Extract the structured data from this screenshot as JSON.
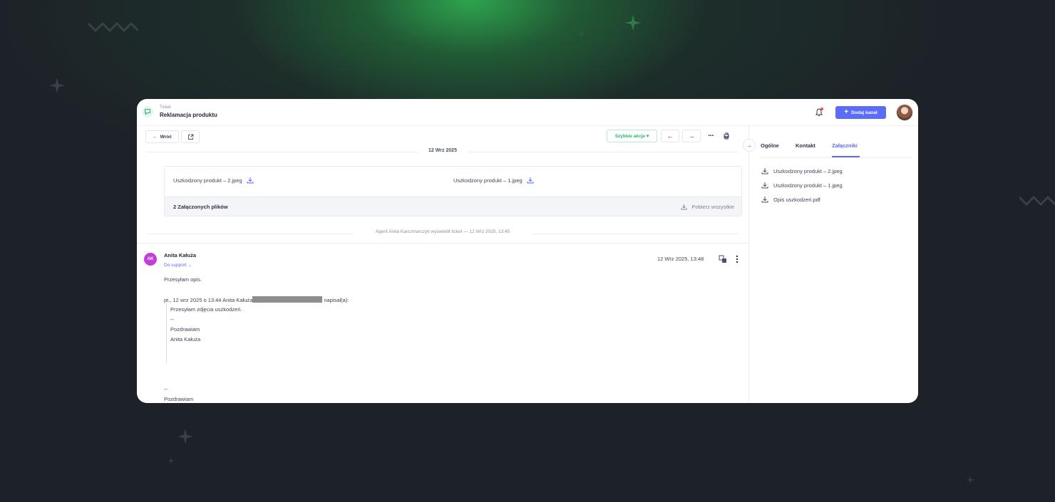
{
  "header": {
    "crumb_small": "Ticket",
    "title": "Reklamacja produktu",
    "add_channel_label": "Dodaj kanał"
  },
  "toolbar": {
    "back_label": "Wróć",
    "quick_actions_label": "Szybkie akcje"
  },
  "conversation": {
    "date_separator": "12 Wrz 2025",
    "attachments": {
      "files": [
        "Uszkodzony produkt – 2.jpeg",
        "Uszkodzony produkt – 1.jpeg"
      ],
      "count_label": "2 Załączonych plików",
      "download_all_label": "Pobierz wszystkie"
    },
    "event": "Agent Anita Karczmarczyk wyświetlił ticket — 12 Wrz 2025, 13:45",
    "message": {
      "avatar_initials": "AK",
      "sender": "Anita Kałuża",
      "to": "Do support",
      "date": "12 Wrz 2025, 13:48",
      "line1": "Przesyłam opis.",
      "quote_intro_before": "pt., 12 wrz 2025 o 13:44 Anita Kałuża",
      "quote_intro_after": "napisał(a):",
      "quote_lines": [
        "Przesyłam zdjęcia uszkodzeń.",
        "--",
        "Pozdrawiam",
        "Anita Kałuża"
      ],
      "signature_dash": "--",
      "signature": "Pozdrawiam"
    }
  },
  "sidebar": {
    "tabs": [
      "Ogólne",
      "Kontakt",
      "Załączniki"
    ],
    "active_tab": "Załączniki",
    "files": [
      "Uszkodzony produkt – 2.jpeg",
      "Uszkodzony produkt – 1.jpeg",
      "Opis uszkodzeń.pdf"
    ]
  },
  "colors": {
    "accent": "#5b6cf6",
    "quick_actions": "#27b36b",
    "avatar": "#c13ed9",
    "background": "#1d2128"
  }
}
